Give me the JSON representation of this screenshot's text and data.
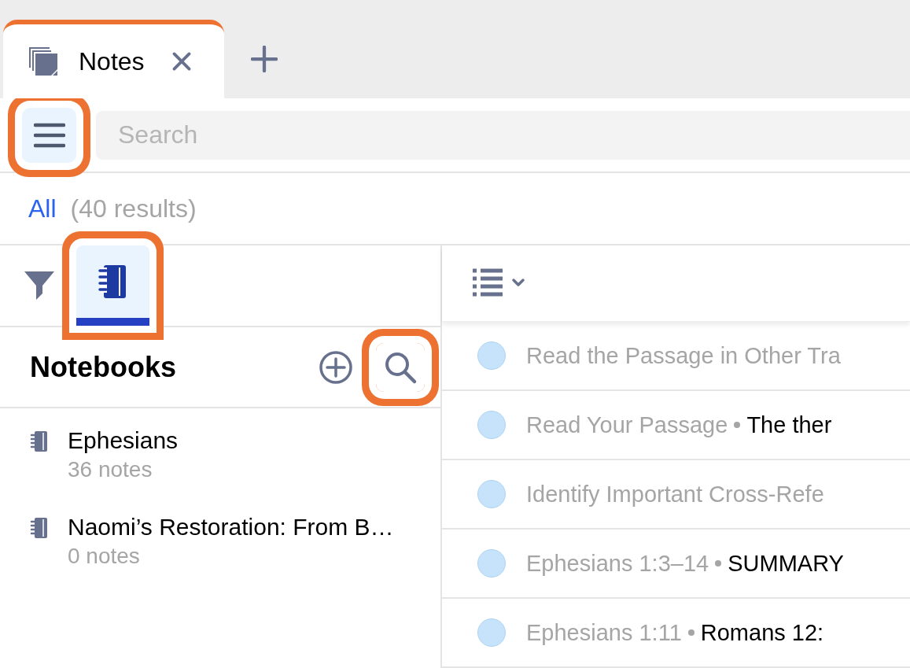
{
  "tabs": [
    {
      "label": "Notes",
      "selected": true
    }
  ],
  "toolbar": {
    "menu_button": {
      "highlighted": true
    },
    "search": {
      "placeholder": "Search"
    }
  },
  "results": {
    "filter": "All",
    "count": "(40 results)"
  },
  "sidebar": {
    "panel_tabs": [
      {
        "kind": "filter",
        "selected": false,
        "highlighted": false
      },
      {
        "kind": "notebooks",
        "selected": true,
        "highlighted": true
      }
    ],
    "title": "Notebooks",
    "add_button": {
      "highlighted": false
    },
    "search_button": {
      "highlighted": true
    },
    "notebooks": [
      {
        "name": "Ephesians",
        "count": "36 notes"
      },
      {
        "name": "Naomi’s Restoration: From B…",
        "count": "0 notes"
      }
    ]
  },
  "notes": [
    {
      "title": "Read the Passage in Other Tra"
    },
    {
      "title": "Read Your Passage",
      "text": "The ther"
    },
    {
      "title": "Identify Important Cross-Refe"
    },
    {
      "title": "Ephesians 1:3–14",
      "text": "SUMMARY"
    },
    {
      "title": "Ephesians 1:11",
      "text": "Romans 12:"
    }
  ]
}
